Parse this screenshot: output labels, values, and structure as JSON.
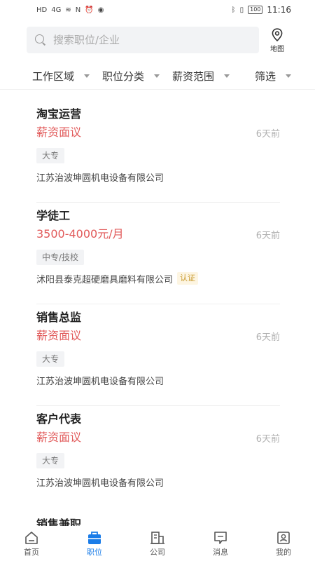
{
  "status_bar": {
    "left_icons": [
      "HD",
      "4G",
      "wifi",
      "N",
      "alarm",
      "wechat"
    ],
    "battery": "100",
    "time": "11:16"
  },
  "search": {
    "placeholder": "搜索职位/企业",
    "map_label": "地图"
  },
  "filters": [
    {
      "label": "工作区域"
    },
    {
      "label": "职位分类"
    },
    {
      "label": "薪资范围"
    },
    {
      "label": "筛选"
    }
  ],
  "jobs": [
    {
      "title": "淘宝运营",
      "salary": "薪资面议",
      "time": "6天前",
      "tag": "大专",
      "company": "江苏治波坤圆机电设备有限公司",
      "verified": ""
    },
    {
      "title": "学徒工",
      "salary": "3500-4000元/月",
      "time": "6天前",
      "tag": "中专/技校",
      "company": "沭阳县泰克超硬磨具磨料有限公司",
      "verified": "认证"
    },
    {
      "title": "销售总监",
      "salary": "薪资面议",
      "time": "6天前",
      "tag": "大专",
      "company": "江苏治波坤圆机电设备有限公司",
      "verified": ""
    },
    {
      "title": "客户代表",
      "salary": "薪资面议",
      "time": "6天前",
      "tag": "大专",
      "company": "江苏治波坤圆机电设备有限公司",
      "verified": ""
    }
  ],
  "partial_job": {
    "title": "销售兼职"
  },
  "tabs": [
    {
      "label": "首页",
      "icon": "home-icon",
      "active": false
    },
    {
      "label": "职位",
      "icon": "briefcase-icon",
      "active": true
    },
    {
      "label": "公司",
      "icon": "building-icon",
      "active": false
    },
    {
      "label": "消息",
      "icon": "message-icon",
      "active": false
    },
    {
      "label": "我的",
      "icon": "profile-icon",
      "active": false
    }
  ],
  "colors": {
    "accent": "#1a7ce8",
    "salary": "#e15a5a",
    "verified": "#c89a2e"
  }
}
